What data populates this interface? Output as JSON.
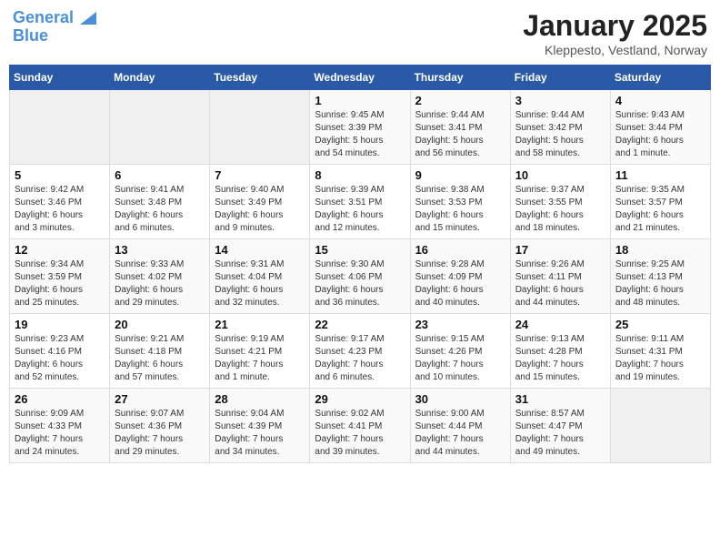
{
  "logo": {
    "line1": "General",
    "line2": "Blue"
  },
  "title": "January 2025",
  "location": "Kleppesto, Vestland, Norway",
  "weekdays": [
    "Sunday",
    "Monday",
    "Tuesday",
    "Wednesday",
    "Thursday",
    "Friday",
    "Saturday"
  ],
  "weeks": [
    [
      {
        "day": "",
        "info": ""
      },
      {
        "day": "",
        "info": ""
      },
      {
        "day": "",
        "info": ""
      },
      {
        "day": "1",
        "info": "Sunrise: 9:45 AM\nSunset: 3:39 PM\nDaylight: 5 hours\nand 54 minutes."
      },
      {
        "day": "2",
        "info": "Sunrise: 9:44 AM\nSunset: 3:41 PM\nDaylight: 5 hours\nand 56 minutes."
      },
      {
        "day": "3",
        "info": "Sunrise: 9:44 AM\nSunset: 3:42 PM\nDaylight: 5 hours\nand 58 minutes."
      },
      {
        "day": "4",
        "info": "Sunrise: 9:43 AM\nSunset: 3:44 PM\nDaylight: 6 hours\nand 1 minute."
      }
    ],
    [
      {
        "day": "5",
        "info": "Sunrise: 9:42 AM\nSunset: 3:46 PM\nDaylight: 6 hours\nand 3 minutes."
      },
      {
        "day": "6",
        "info": "Sunrise: 9:41 AM\nSunset: 3:48 PM\nDaylight: 6 hours\nand 6 minutes."
      },
      {
        "day": "7",
        "info": "Sunrise: 9:40 AM\nSunset: 3:49 PM\nDaylight: 6 hours\nand 9 minutes."
      },
      {
        "day": "8",
        "info": "Sunrise: 9:39 AM\nSunset: 3:51 PM\nDaylight: 6 hours\nand 12 minutes."
      },
      {
        "day": "9",
        "info": "Sunrise: 9:38 AM\nSunset: 3:53 PM\nDaylight: 6 hours\nand 15 minutes."
      },
      {
        "day": "10",
        "info": "Sunrise: 9:37 AM\nSunset: 3:55 PM\nDaylight: 6 hours\nand 18 minutes."
      },
      {
        "day": "11",
        "info": "Sunrise: 9:35 AM\nSunset: 3:57 PM\nDaylight: 6 hours\nand 21 minutes."
      }
    ],
    [
      {
        "day": "12",
        "info": "Sunrise: 9:34 AM\nSunset: 3:59 PM\nDaylight: 6 hours\nand 25 minutes."
      },
      {
        "day": "13",
        "info": "Sunrise: 9:33 AM\nSunset: 4:02 PM\nDaylight: 6 hours\nand 29 minutes."
      },
      {
        "day": "14",
        "info": "Sunrise: 9:31 AM\nSunset: 4:04 PM\nDaylight: 6 hours\nand 32 minutes."
      },
      {
        "day": "15",
        "info": "Sunrise: 9:30 AM\nSunset: 4:06 PM\nDaylight: 6 hours\nand 36 minutes."
      },
      {
        "day": "16",
        "info": "Sunrise: 9:28 AM\nSunset: 4:09 PM\nDaylight: 6 hours\nand 40 minutes."
      },
      {
        "day": "17",
        "info": "Sunrise: 9:26 AM\nSunset: 4:11 PM\nDaylight: 6 hours\nand 44 minutes."
      },
      {
        "day": "18",
        "info": "Sunrise: 9:25 AM\nSunset: 4:13 PM\nDaylight: 6 hours\nand 48 minutes."
      }
    ],
    [
      {
        "day": "19",
        "info": "Sunrise: 9:23 AM\nSunset: 4:16 PM\nDaylight: 6 hours\nand 52 minutes."
      },
      {
        "day": "20",
        "info": "Sunrise: 9:21 AM\nSunset: 4:18 PM\nDaylight: 6 hours\nand 57 minutes."
      },
      {
        "day": "21",
        "info": "Sunrise: 9:19 AM\nSunset: 4:21 PM\nDaylight: 7 hours\nand 1 minute."
      },
      {
        "day": "22",
        "info": "Sunrise: 9:17 AM\nSunset: 4:23 PM\nDaylight: 7 hours\nand 6 minutes."
      },
      {
        "day": "23",
        "info": "Sunrise: 9:15 AM\nSunset: 4:26 PM\nDaylight: 7 hours\nand 10 minutes."
      },
      {
        "day": "24",
        "info": "Sunrise: 9:13 AM\nSunset: 4:28 PM\nDaylight: 7 hours\nand 15 minutes."
      },
      {
        "day": "25",
        "info": "Sunrise: 9:11 AM\nSunset: 4:31 PM\nDaylight: 7 hours\nand 19 minutes."
      }
    ],
    [
      {
        "day": "26",
        "info": "Sunrise: 9:09 AM\nSunset: 4:33 PM\nDaylight: 7 hours\nand 24 minutes."
      },
      {
        "day": "27",
        "info": "Sunrise: 9:07 AM\nSunset: 4:36 PM\nDaylight: 7 hours\nand 29 minutes."
      },
      {
        "day": "28",
        "info": "Sunrise: 9:04 AM\nSunset: 4:39 PM\nDaylight: 7 hours\nand 34 minutes."
      },
      {
        "day": "29",
        "info": "Sunrise: 9:02 AM\nSunset: 4:41 PM\nDaylight: 7 hours\nand 39 minutes."
      },
      {
        "day": "30",
        "info": "Sunrise: 9:00 AM\nSunset: 4:44 PM\nDaylight: 7 hours\nand 44 minutes."
      },
      {
        "day": "31",
        "info": "Sunrise: 8:57 AM\nSunset: 4:47 PM\nDaylight: 7 hours\nand 49 minutes."
      },
      {
        "day": "",
        "info": ""
      }
    ]
  ]
}
